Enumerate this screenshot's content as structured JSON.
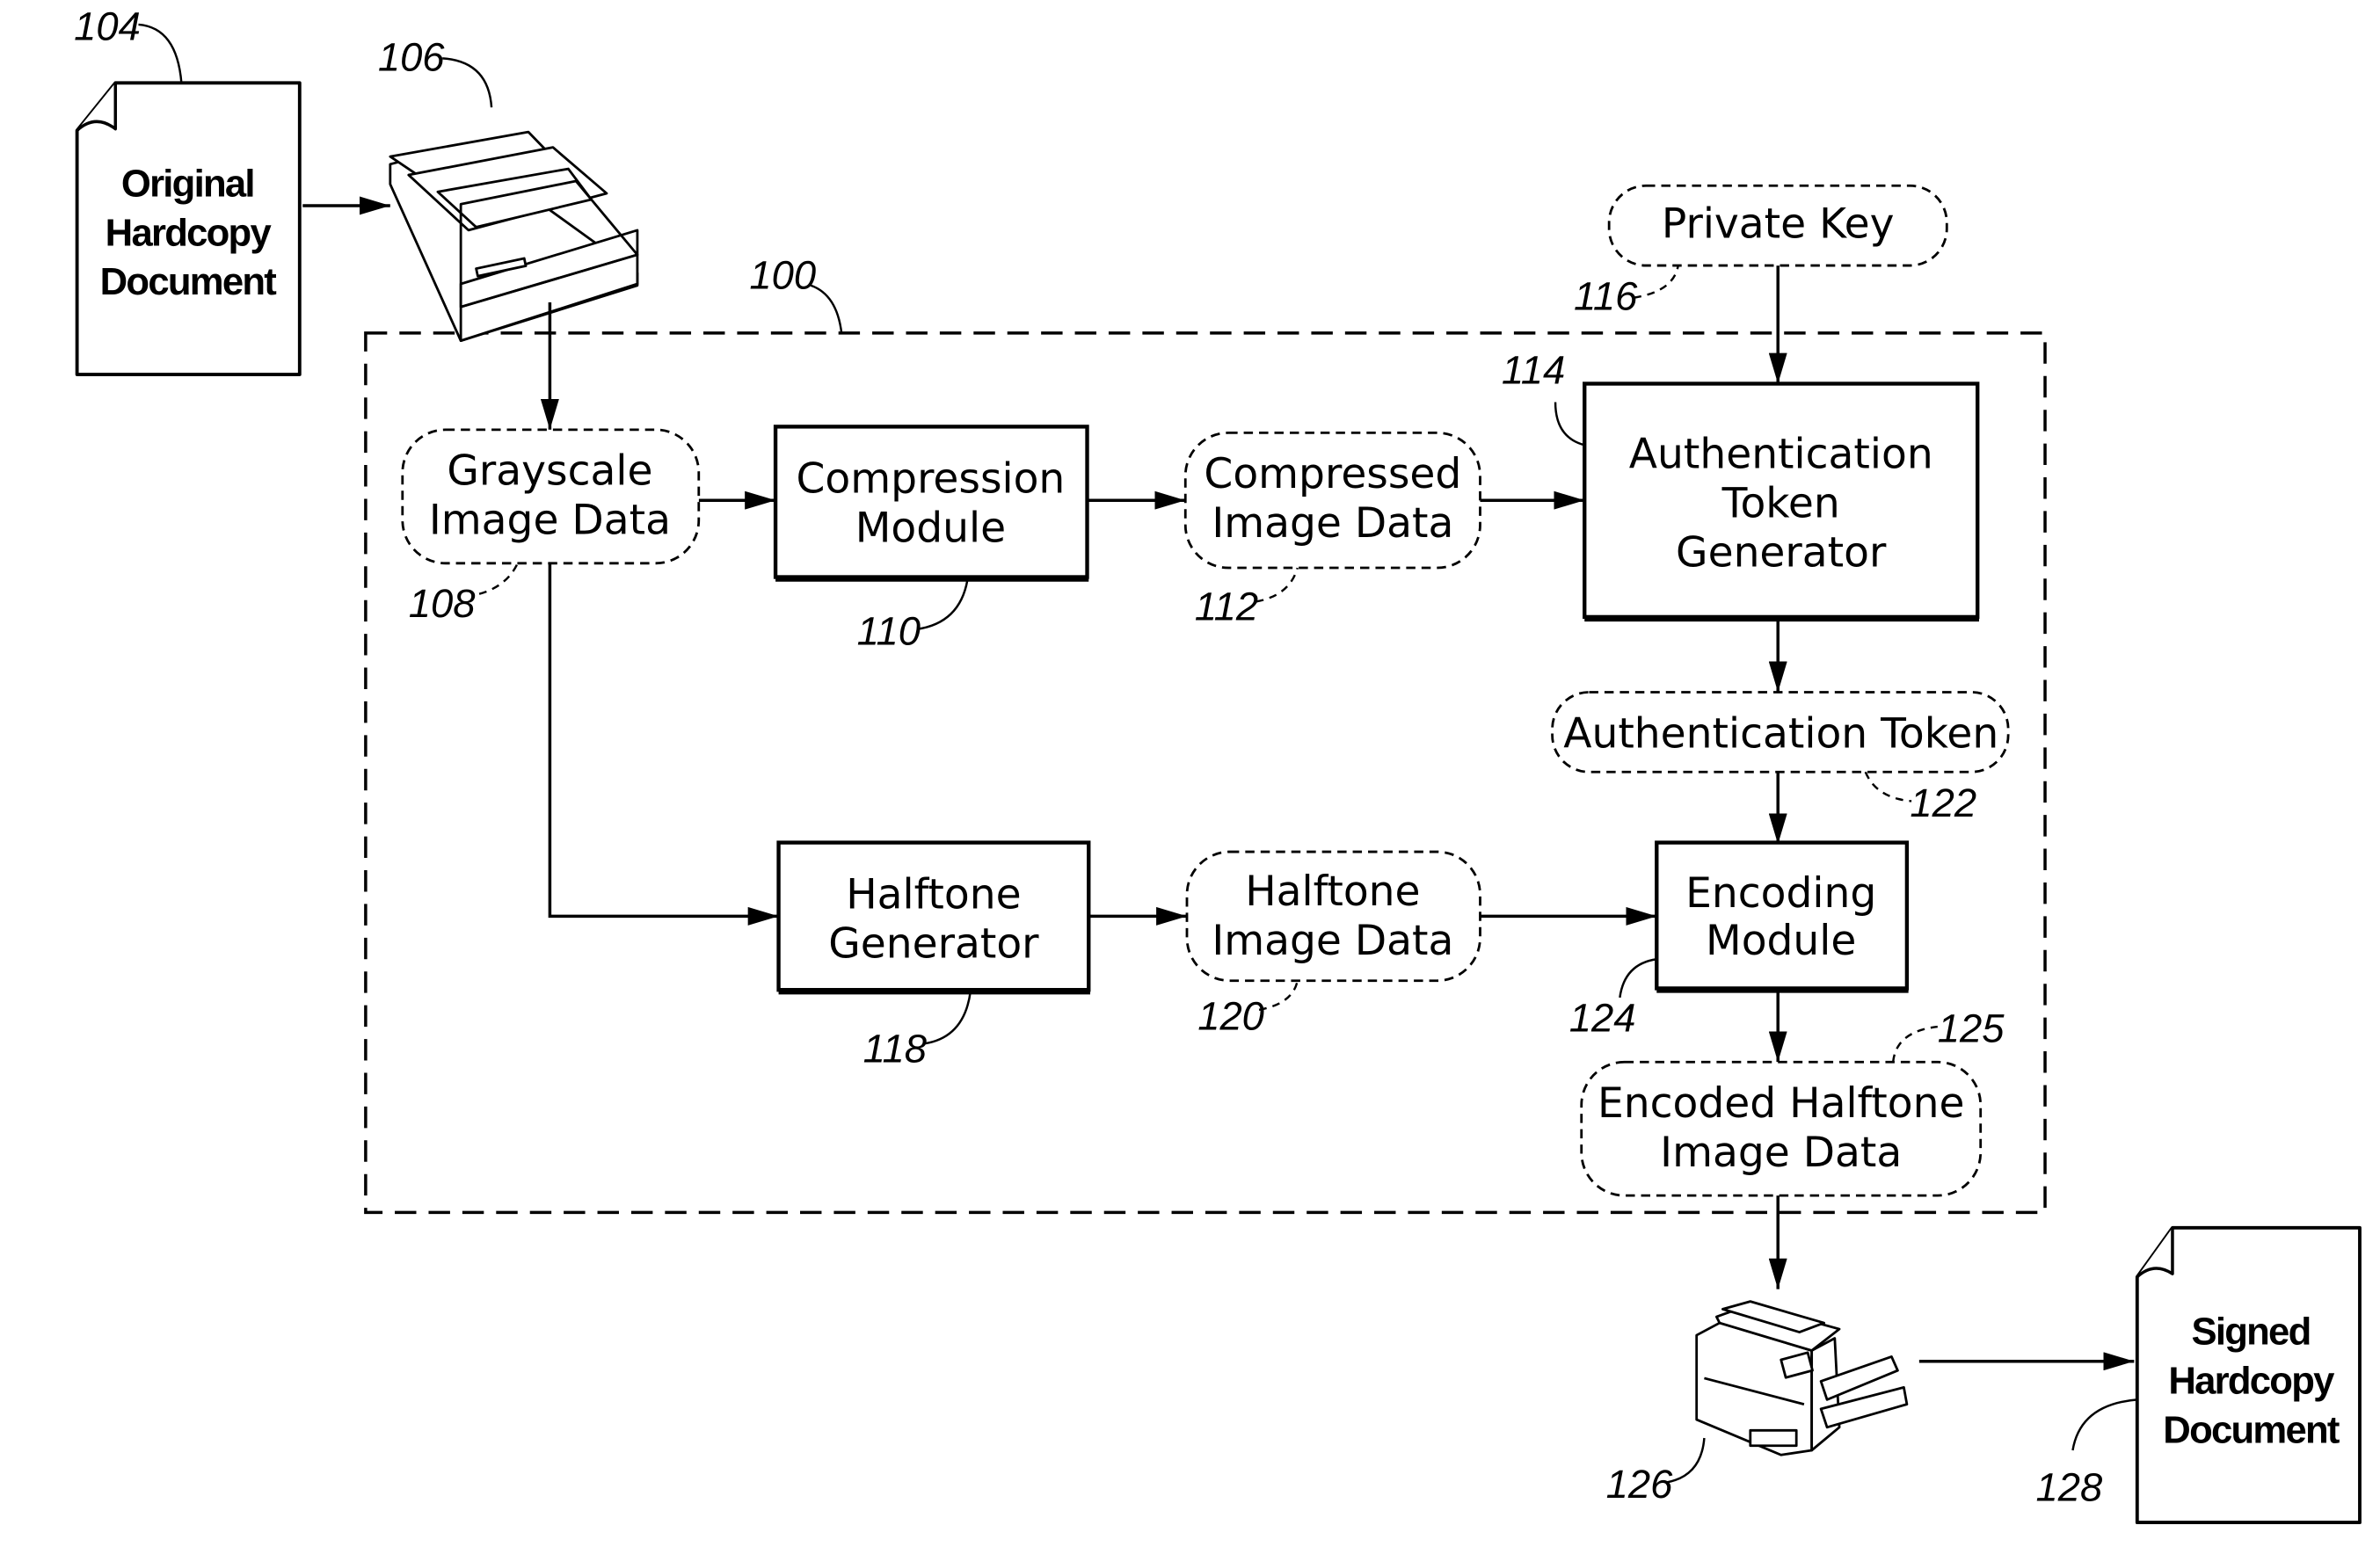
{
  "figure": {
    "system": {
      "ref": "100"
    },
    "documents": {
      "original": {
        "ref": "104",
        "lines": [
          "Original",
          "Hardcopy",
          "Document"
        ]
      },
      "signed": {
        "ref": "128",
        "lines": [
          "Signed",
          "Hardcopy",
          "Document"
        ]
      }
    },
    "devices": {
      "scanner": {
        "ref": "106",
        "icon": "scanner-icon"
      },
      "printer": {
        "ref": "126",
        "icon": "printer-icon"
      }
    },
    "nodes": {
      "grayscale": {
        "ref": "108",
        "kind": "data",
        "lines": [
          "Grayscale",
          "Image Data"
        ]
      },
      "compression": {
        "ref": "110",
        "kind": "module",
        "lines": [
          "Compression",
          "Module"
        ]
      },
      "compressed": {
        "ref": "112",
        "kind": "data",
        "lines": [
          "Compressed",
          "Image Data"
        ]
      },
      "auth_gen": {
        "ref": "114",
        "kind": "module",
        "lines": [
          "Authentication",
          "Token",
          "Generator"
        ]
      },
      "private_key": {
        "ref": "116",
        "kind": "data",
        "lines": [
          "Private Key"
        ]
      },
      "halftone_gen": {
        "ref": "118",
        "kind": "module",
        "lines": [
          "Halftone",
          "Generator"
        ]
      },
      "halftone_data": {
        "ref": "120",
        "kind": "data",
        "lines": [
          "Halftone",
          "Image Data"
        ]
      },
      "auth_token": {
        "ref": "122",
        "kind": "data",
        "lines": [
          "Authentication Token"
        ]
      },
      "encoding": {
        "ref": "124",
        "kind": "module",
        "lines": [
          "Encoding",
          "Module"
        ]
      },
      "encoded": {
        "ref": "125",
        "kind": "data",
        "lines": [
          "Encoded Halftone",
          "Image Data"
        ]
      }
    },
    "edges": [
      [
        "original",
        "scanner"
      ],
      [
        "scanner",
        "grayscale"
      ],
      [
        "grayscale",
        "compression"
      ],
      [
        "compression",
        "compressed"
      ],
      [
        "compressed",
        "auth_gen"
      ],
      [
        "private_key",
        "auth_gen"
      ],
      [
        "auth_gen",
        "auth_token"
      ],
      [
        "grayscale",
        "halftone_gen"
      ],
      [
        "halftone_gen",
        "halftone_data"
      ],
      [
        "halftone_data",
        "encoding"
      ],
      [
        "auth_token",
        "encoding"
      ],
      [
        "encoding",
        "encoded"
      ],
      [
        "encoded",
        "printer"
      ],
      [
        "printer",
        "signed"
      ]
    ]
  }
}
